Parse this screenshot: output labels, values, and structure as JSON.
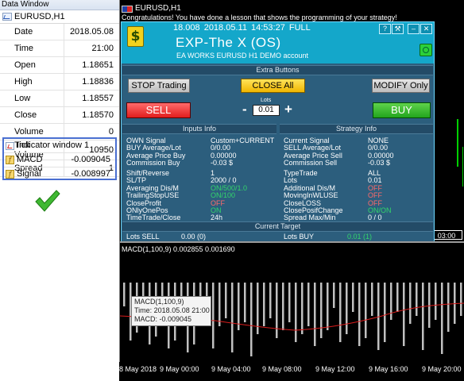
{
  "data_window": {
    "title": "Data Window",
    "symbol": "EURUSD,H1",
    "rows": [
      {
        "key": "Date",
        "value": "2018.05.08"
      },
      {
        "key": "Time",
        "value": "21:00"
      },
      {
        "key": "Open",
        "value": "1.18651"
      },
      {
        "key": "High",
        "value": "1.18836"
      },
      {
        "key": "Low",
        "value": "1.18557"
      },
      {
        "key": "Close",
        "value": "1.18570"
      },
      {
        "key": "Volume",
        "value": "0"
      },
      {
        "key": "Tick Volume",
        "value": "10950"
      },
      {
        "key": "Spread",
        "value": "1"
      }
    ],
    "indicator_window": "Indicator window 1",
    "indicators": [
      {
        "key": "MACD",
        "value": "-0.009045"
      },
      {
        "key": "Signal",
        "value": "-0.008997"
      }
    ]
  },
  "chart": {
    "tab_label": "EURUSD,H1",
    "message": "Congratulations! You have done a lesson that shows the programming of your strategy!",
    "time_marker": "03:00"
  },
  "panel": {
    "header_info": "18.008  2018.05.11 14:53:27   FULL",
    "name": "EXP-The X (OS)",
    "account": "EA WORKS EURUSD  H1 DEMO account",
    "help_btn": "?",
    "tools_btn": "⚒",
    "min_btn": "–",
    "close_btn": "✕",
    "extra_buttons_title": "Extra Buttons",
    "stop_trading": "STOP Trading",
    "close_all": "CLOSE All",
    "modify_only": "MODIFY Only",
    "sell": "SELL",
    "buy": "BUY",
    "lots_label": "Lots",
    "lots_value": "0.01",
    "minus": "-",
    "plus": "+",
    "inputs_title": "Inputs Info",
    "strategy_title": "Strategy Info",
    "current_target_title": "Current Target",
    "inputs_labels_1": "OWN Signal\nBUY Average/Lot\nAverage Price Buy\nCommission Buy",
    "inputs_values_1": "Custom+CURRENT\n0/0.00\n0.00000\n-0.03 $",
    "inputs_labels_2": "Shift/Reverse\nSL/TP\nAveraging Dis/M\nTrailingStopUSE\nCloseProfit\nONlyOnePos\nTimeTrade/Close",
    "inputs_values_2_white_a": "1\n2000 / 0",
    "inputs_values_2_green_a": "ON/500/1.0\nON/100",
    "inputs_values_2_red": "OFF",
    "inputs_values_2_green_b": "ON",
    "inputs_values_2_white_b": "24h",
    "strategy_labels_1": "Current Signal\nSELL Average/Lot\nAverage Price Sell\nCommission Sell",
    "strategy_values_1": "NONE\n0/0.00\n0.00000\n-0.03 $",
    "strategy_labels_2": "TypeTrade\nLots\nAdditional Dis/M\nMovingInWLUSE\nCloseLOSS\nClosePosifChange\nSpread Max/Min",
    "strategy_values_2_white": "ALL\n0.01",
    "strategy_values_2_red": "OFF\nOFF\nOFF",
    "strategy_values_2_green": "ON/ON",
    "strategy_values_2_white_b": "0 / 0",
    "lots_sell_label": "Lots SELL",
    "lots_sell_value": "0.00 (0)",
    "lots_buy_label": "Lots BUY",
    "lots_buy_value": "0.01 (1)"
  },
  "macd": {
    "title": "MACD(1,100,9) 0.002855 0.001690",
    "tooltip_name": "MACD(1,100,9)",
    "tooltip_time": "Time: 2018.05.08 21:00",
    "tooltip_value": "MACD: -0.009045",
    "x_labels": [
      "8 May 2018",
      "9 May 00:00",
      "9 May 04:00",
      "9 May 08:00",
      "9 May 12:00",
      "9 May 16:00",
      "9 May 20:00"
    ]
  },
  "colors": {
    "panel_bg": "#2c5e7d",
    "panel_header": "#14a7ca",
    "sell": "#e11d1d",
    "buy": "#22a51d",
    "close_all": "#f0b600",
    "signal_line": "#d81c1c",
    "histogram": "#c0c0c0"
  }
}
